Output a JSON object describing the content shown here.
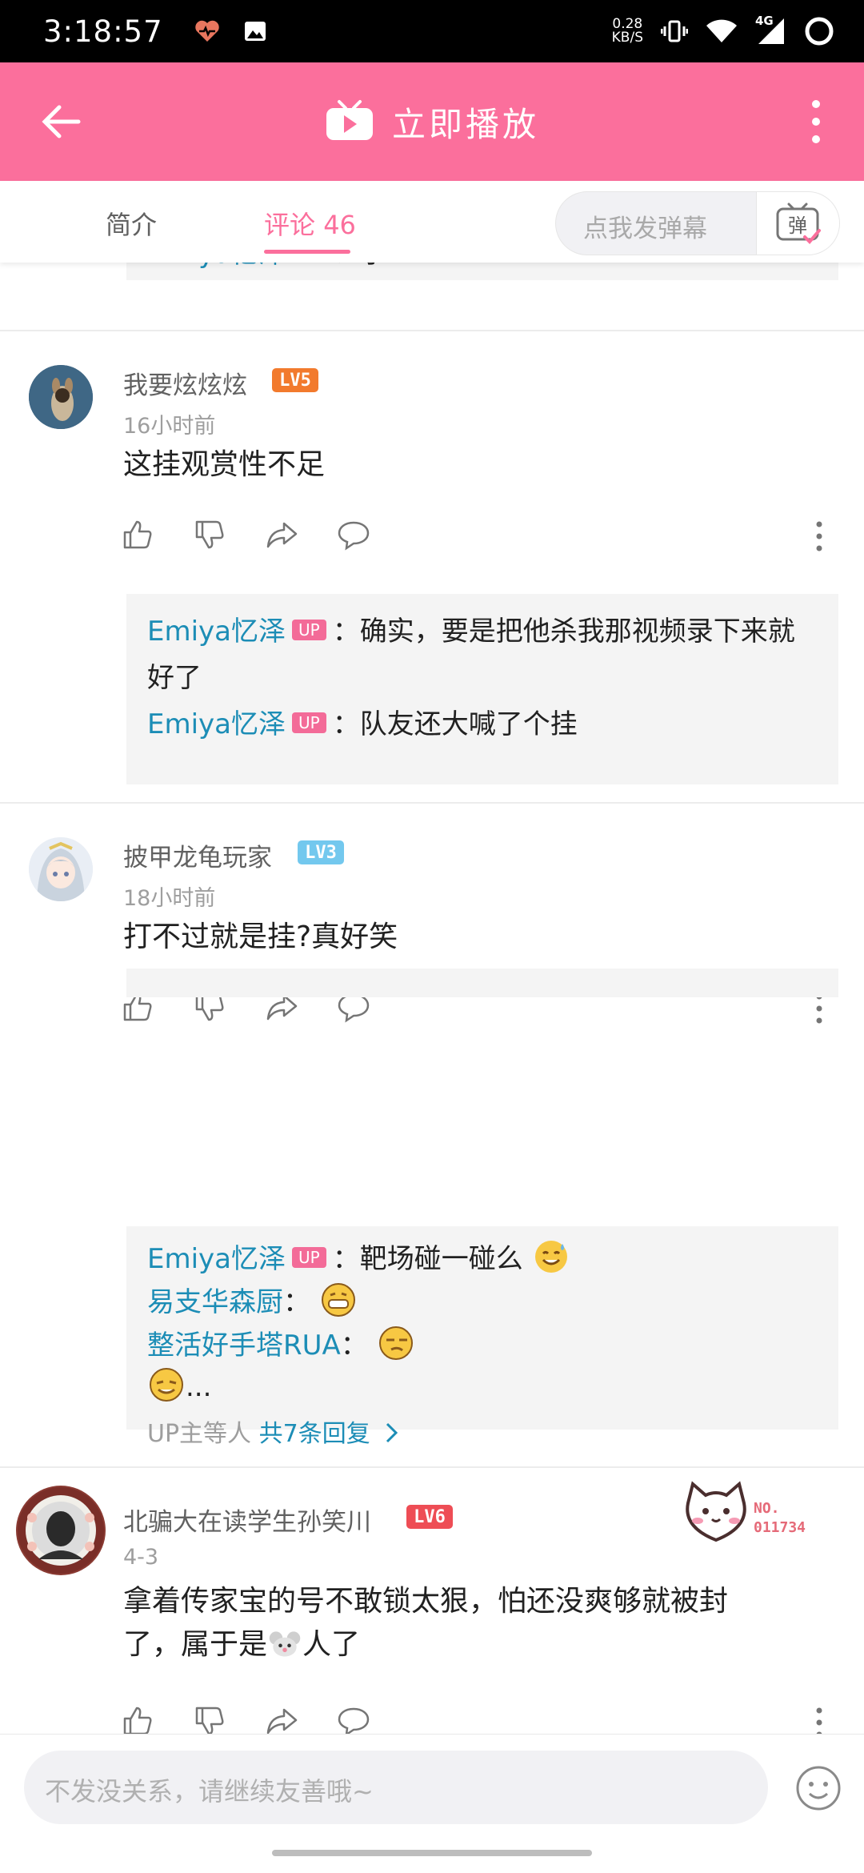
{
  "status_bar": {
    "time": "3:18:57",
    "net_speed_value": "0.28",
    "net_speed_unit": "KB/S",
    "network": "4G"
  },
  "app_bar": {
    "title": "立即播放"
  },
  "tabs": {
    "intro": "简介",
    "comments_label": "评论",
    "comments_count": "46"
  },
  "danmaku": {
    "placeholder": "点我发弹幕",
    "button_label": "弹"
  },
  "partial_top_reply": {
    "author": "Emiya忆泽",
    "text": "：示"
  },
  "comments": [
    {
      "user": "我要炫炫炫",
      "level": "LV5",
      "level_color": "#f27a2d",
      "time": "16小时前",
      "text": "这挂观赏性不足",
      "replies": [
        {
          "author": "Emiya忆泽",
          "up": "UP",
          "text": "：确实，要是把他杀我那视频录下来就好了"
        },
        {
          "author": "Emiya忆泽",
          "up": "UP",
          "text": "：队友还大喊了个挂"
        }
      ]
    },
    {
      "user": "披甲龙龟玩家",
      "level": "LV3",
      "level_color": "#73c8ee",
      "time": "18小时前",
      "text": "打不过就是挂?真好笑",
      "replies": [
        {
          "author": "Emiya忆泽",
          "up": "UP",
          "text": "：靶场碰一碰么"
        },
        {
          "author": "易支华森厨",
          "text": "："
        },
        {
          "author": "整活好手塔RUA",
          "text": "："
        },
        {
          "author": "",
          "text": "..."
        }
      ],
      "more": {
        "prefix": "UP主等人",
        "count": "共7条回复"
      }
    },
    {
      "user": "北骗大在读学生孙笑川",
      "level": "LV6",
      "level_color": "#ee4d55",
      "time": "4-3",
      "text_line1": "拿着传家宝的号不敢锁太狠，怕还没爽够就被封",
      "text_line2a": "了，属于是",
      "text_line2b": "人了",
      "badge": {
        "label": "NO.",
        "number": "011734"
      }
    }
  ],
  "input_bar": {
    "placeholder": "不发没关系，请继续友善哦~"
  },
  "colors": {
    "accent": "#fb6f9c",
    "link": "#1c8db6",
    "up_badge": "#f36b98"
  }
}
